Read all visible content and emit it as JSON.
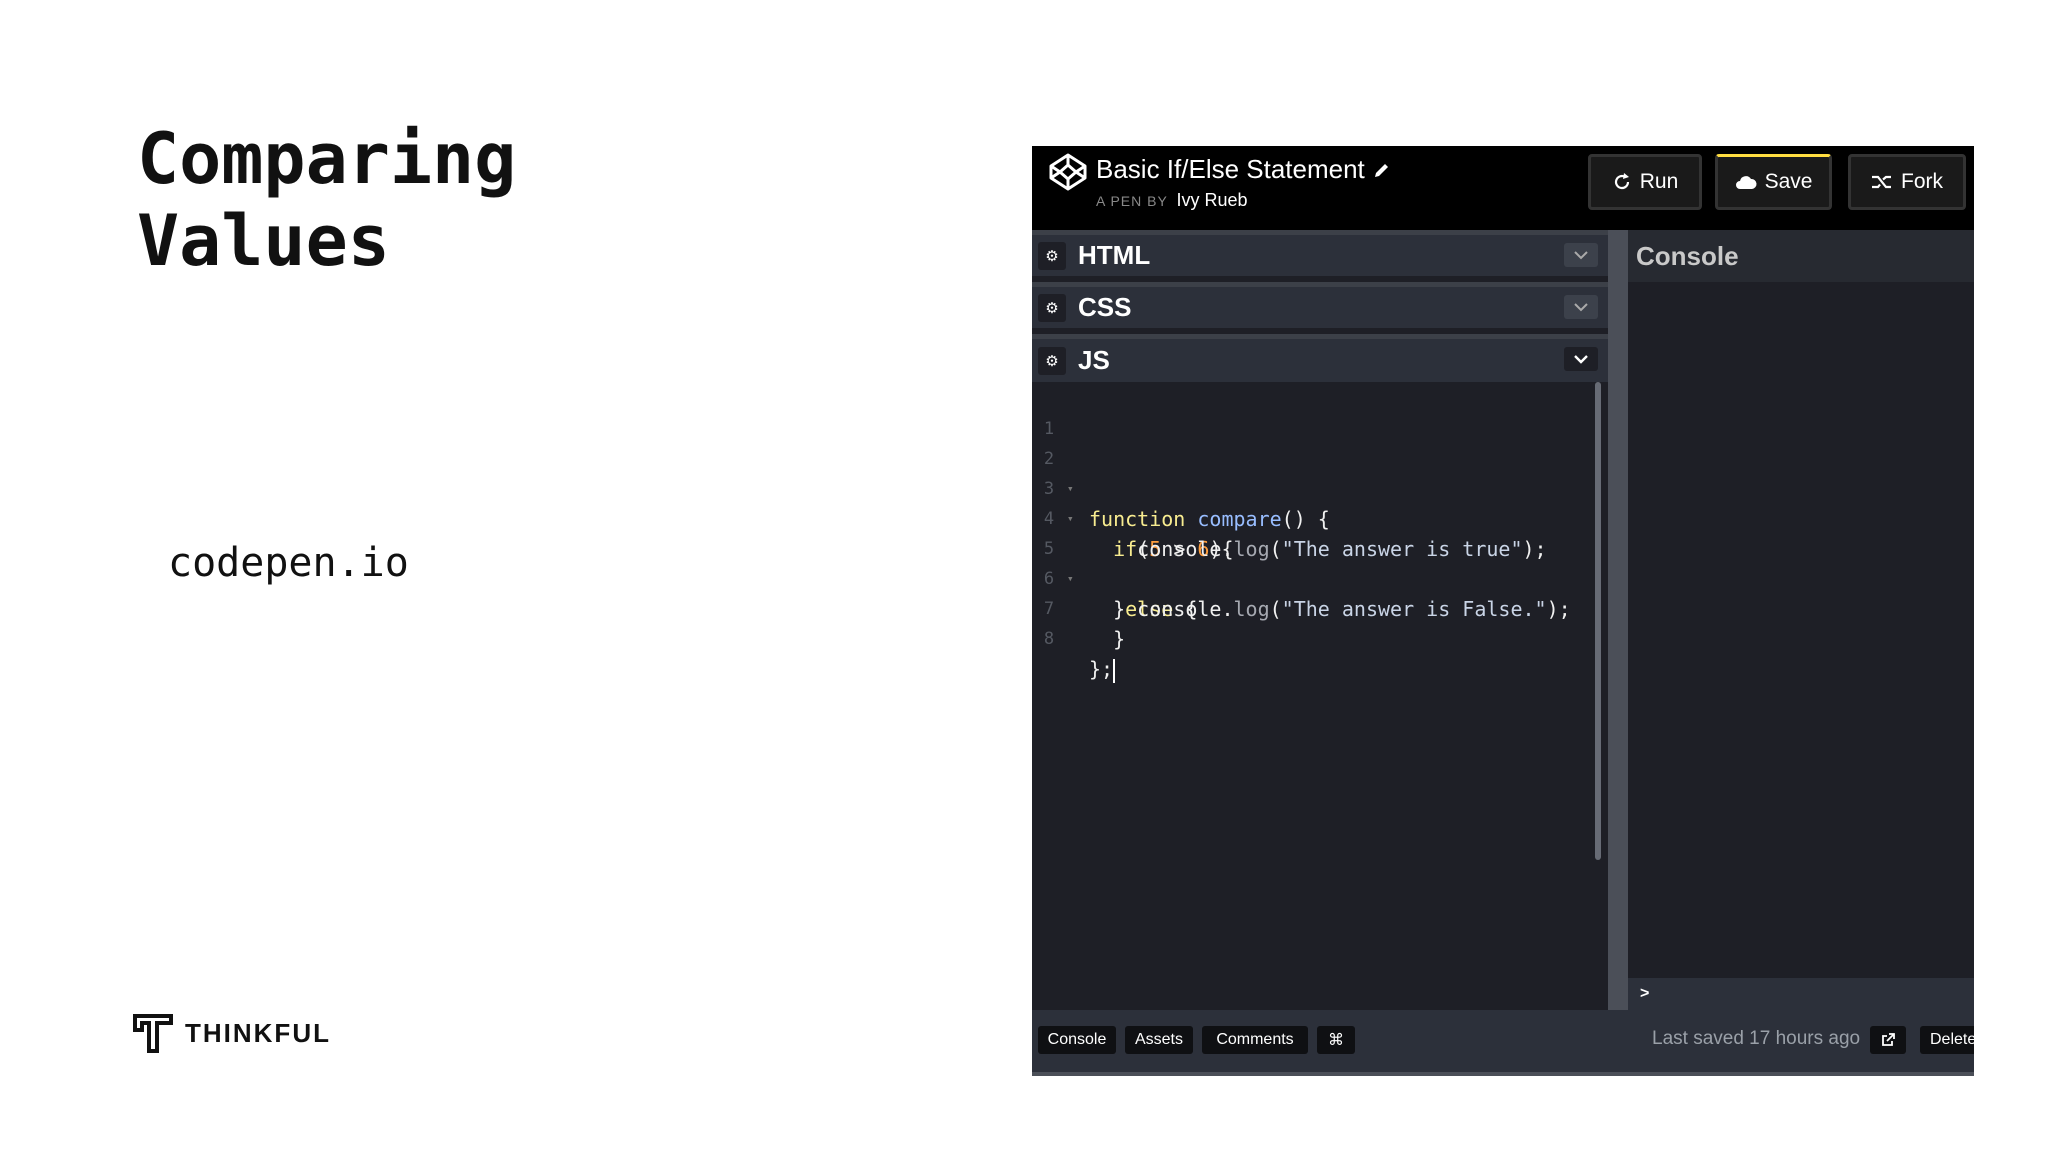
{
  "slide": {
    "title_line1": "Comparing",
    "title_line2": "Values",
    "link_text": "codepen.io",
    "brand": "THINKFUL"
  },
  "pen": {
    "title": "Basic If/Else Statement",
    "by_label": "A PEN BY",
    "author": "Ivy Rueb",
    "buttons": {
      "run": "Run",
      "save": "Save",
      "fork": "Fork"
    },
    "editors": [
      {
        "label": "HTML"
      },
      {
        "label": "CSS"
      },
      {
        "label": "JS"
      }
    ],
    "code_lines": [
      {
        "n": "1",
        "text": ""
      },
      {
        "n": "2",
        "text": "function compare() {"
      },
      {
        "n": "3",
        "text": "  if(5 > 6){"
      },
      {
        "n": "4",
        "text": "    console.log(\"The answer is true\");"
      },
      {
        "n": "5",
        "text": "  }else {"
      },
      {
        "n": "6",
        "text": "    console.log(\"The answer is False.\");"
      },
      {
        "n": "7",
        "text": "  }"
      },
      {
        "n": "8",
        "text": "};"
      }
    ],
    "console_title": "Console",
    "console_prompt": ">",
    "footer": {
      "buttons": [
        "Console",
        "Assets",
        "Comments",
        "⌘"
      ],
      "last_saved": "Last saved 17 hours ago",
      "delete_label": "Delete"
    }
  },
  "colors": {
    "editor_bg": "#1e1f26",
    "header_bg": "#000000",
    "save_accent": "#ffdd40",
    "keyword": "#f8ec90",
    "function_name": "#98bdff",
    "number": "#ff9d3d"
  }
}
